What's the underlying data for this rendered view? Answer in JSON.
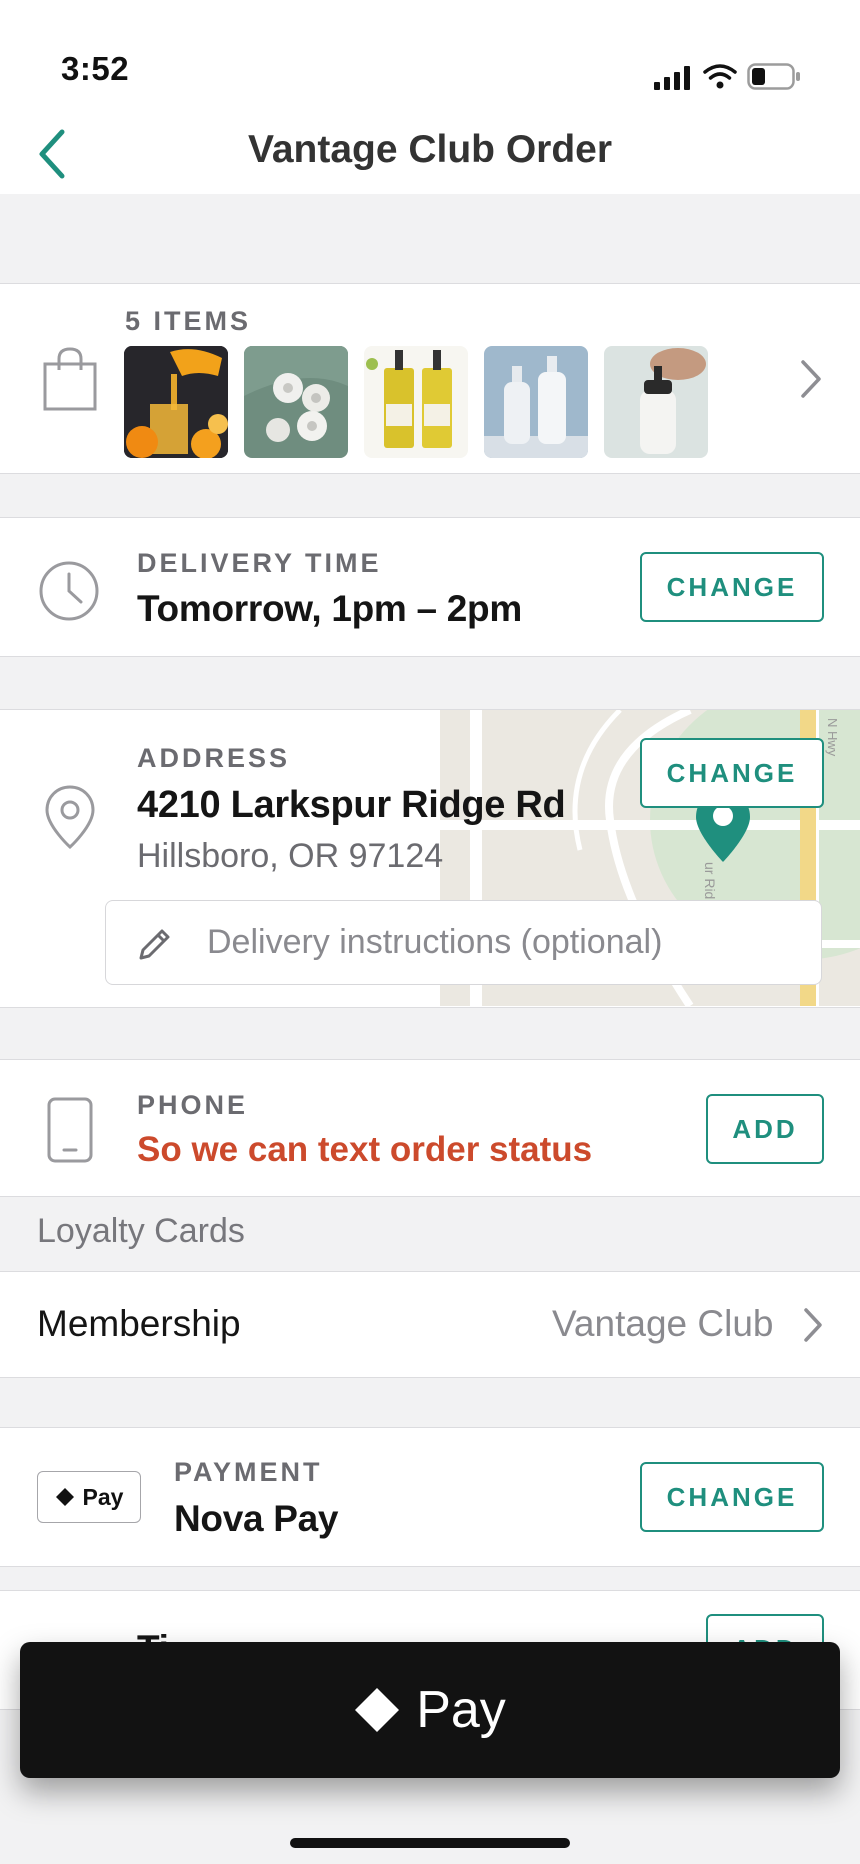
{
  "status_bar": {
    "time": "3:52"
  },
  "nav": {
    "title": "Vantage Club Order"
  },
  "items": {
    "count_label": "5 ITEMS",
    "thumbnails": [
      "orange-juice",
      "toilet-paper",
      "olive-oil-bottles",
      "pump-bottles",
      "hand-soap"
    ]
  },
  "delivery": {
    "label": "DELIVERY TIME",
    "value": "Tomorrow, 1pm – 2pm",
    "button": "CHANGE"
  },
  "address": {
    "label": "ADDRESS",
    "line1": "4210 Larkspur Ridge Rd",
    "line2": "Hillsboro, OR 97124",
    "button": "CHANGE",
    "instructions_placeholder": "Delivery instructions (optional)",
    "map_road_label": "ur Ridge",
    "map_road_label_2": "N Hwy"
  },
  "phone": {
    "label": "PHONE",
    "prompt": "So we can text order status",
    "button": "ADD"
  },
  "loyalty": {
    "header": "Loyalty Cards",
    "membership_label": "Membership",
    "membership_value": "Vantage Club"
  },
  "payment": {
    "badge": "Pay",
    "label": "PAYMENT",
    "value": "Nova Pay",
    "button": "CHANGE"
  },
  "next_row": {
    "partial_label": "Ti",
    "button": "ADD"
  },
  "pay_button": {
    "label": "Pay"
  },
  "colors": {
    "accent": "#1f8f7e",
    "warning_text": "#cc4a2c",
    "pay_button_bg": "#121212"
  }
}
